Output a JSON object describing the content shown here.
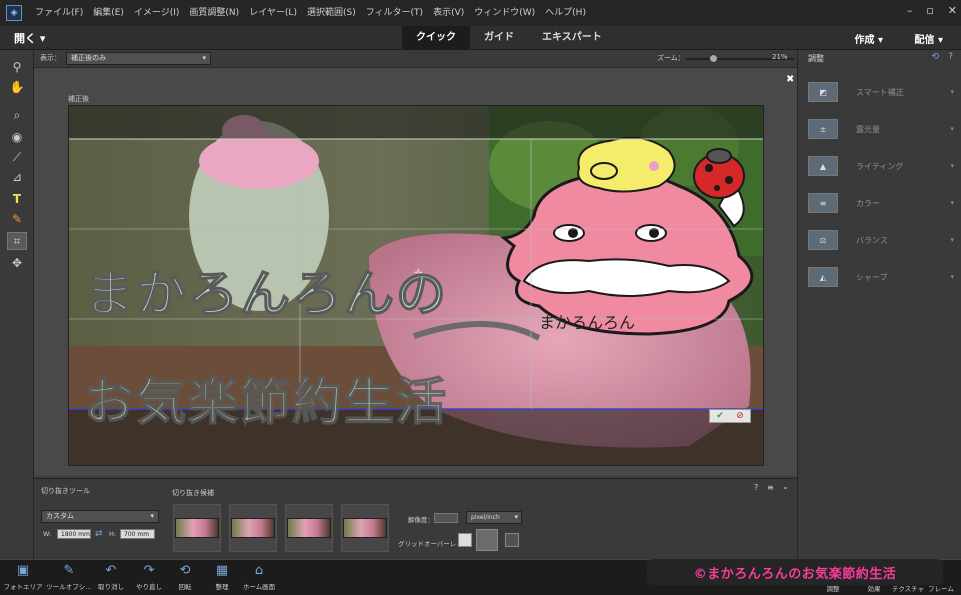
{
  "menu": [
    "ファイル(F)",
    "編集(E)",
    "イメージ(I)",
    "画質調整(N)",
    "レイヤー(L)",
    "選択範囲(S)",
    "フィルター(T)",
    "表示(V)",
    "ウィンドウ(W)",
    "ヘルプ(H)"
  ],
  "toolbar": {
    "open_label": "開く ▾",
    "modes": [
      "クイック",
      "ガイド",
      "エキスパート"
    ],
    "active_mode": "クイック",
    "create_label": "作成 ▾",
    "share_label": "配信 ▾"
  },
  "options": {
    "view_label": "表示：",
    "view_value": "補正後のみ",
    "zoom_label": "ズーム：",
    "zoom_value": "21%",
    "zoom_level": 0.21
  },
  "canvas": {
    "after_label": "補正後",
    "title_line1": "まかろんろんの",
    "title_line2": "お気楽節約生活",
    "sign_text": "まかろんろん"
  },
  "commit": {
    "ok": "✔",
    "cancel": "⊘"
  },
  "crop_panel": {
    "title": "切り抜きツール",
    "preset": "カスタム",
    "w_label": "W:",
    "w_value": "1800 mm",
    "h_label": "H:",
    "h_value": "700 mm",
    "candidates_title": "切り抜き候補",
    "resolution_label": "解像度：",
    "resolution_unit": "pixel/inch",
    "grid_overlay_label": "グリッドオーバーレイ："
  },
  "adjustments": {
    "title": "調整",
    "items": [
      "スマート補正",
      "露光量",
      "ライティング",
      "カラー",
      "バランス",
      "シャープ"
    ]
  },
  "taskbar": {
    "left": [
      "フォトエリア",
      "ツールオプシ…",
      "取り消し",
      "やり直し",
      "回転",
      "整理",
      "ホーム画面"
    ],
    "right": [
      "調整",
      "効果",
      "テクスチャ",
      "フレーム"
    ]
  },
  "watermark": "©まかろんろんのお気楽節約生活",
  "colors": {
    "accent_pink": "#ff3f9f",
    "panel": "#3a3a3a",
    "title_text": "#b6e1c0"
  }
}
